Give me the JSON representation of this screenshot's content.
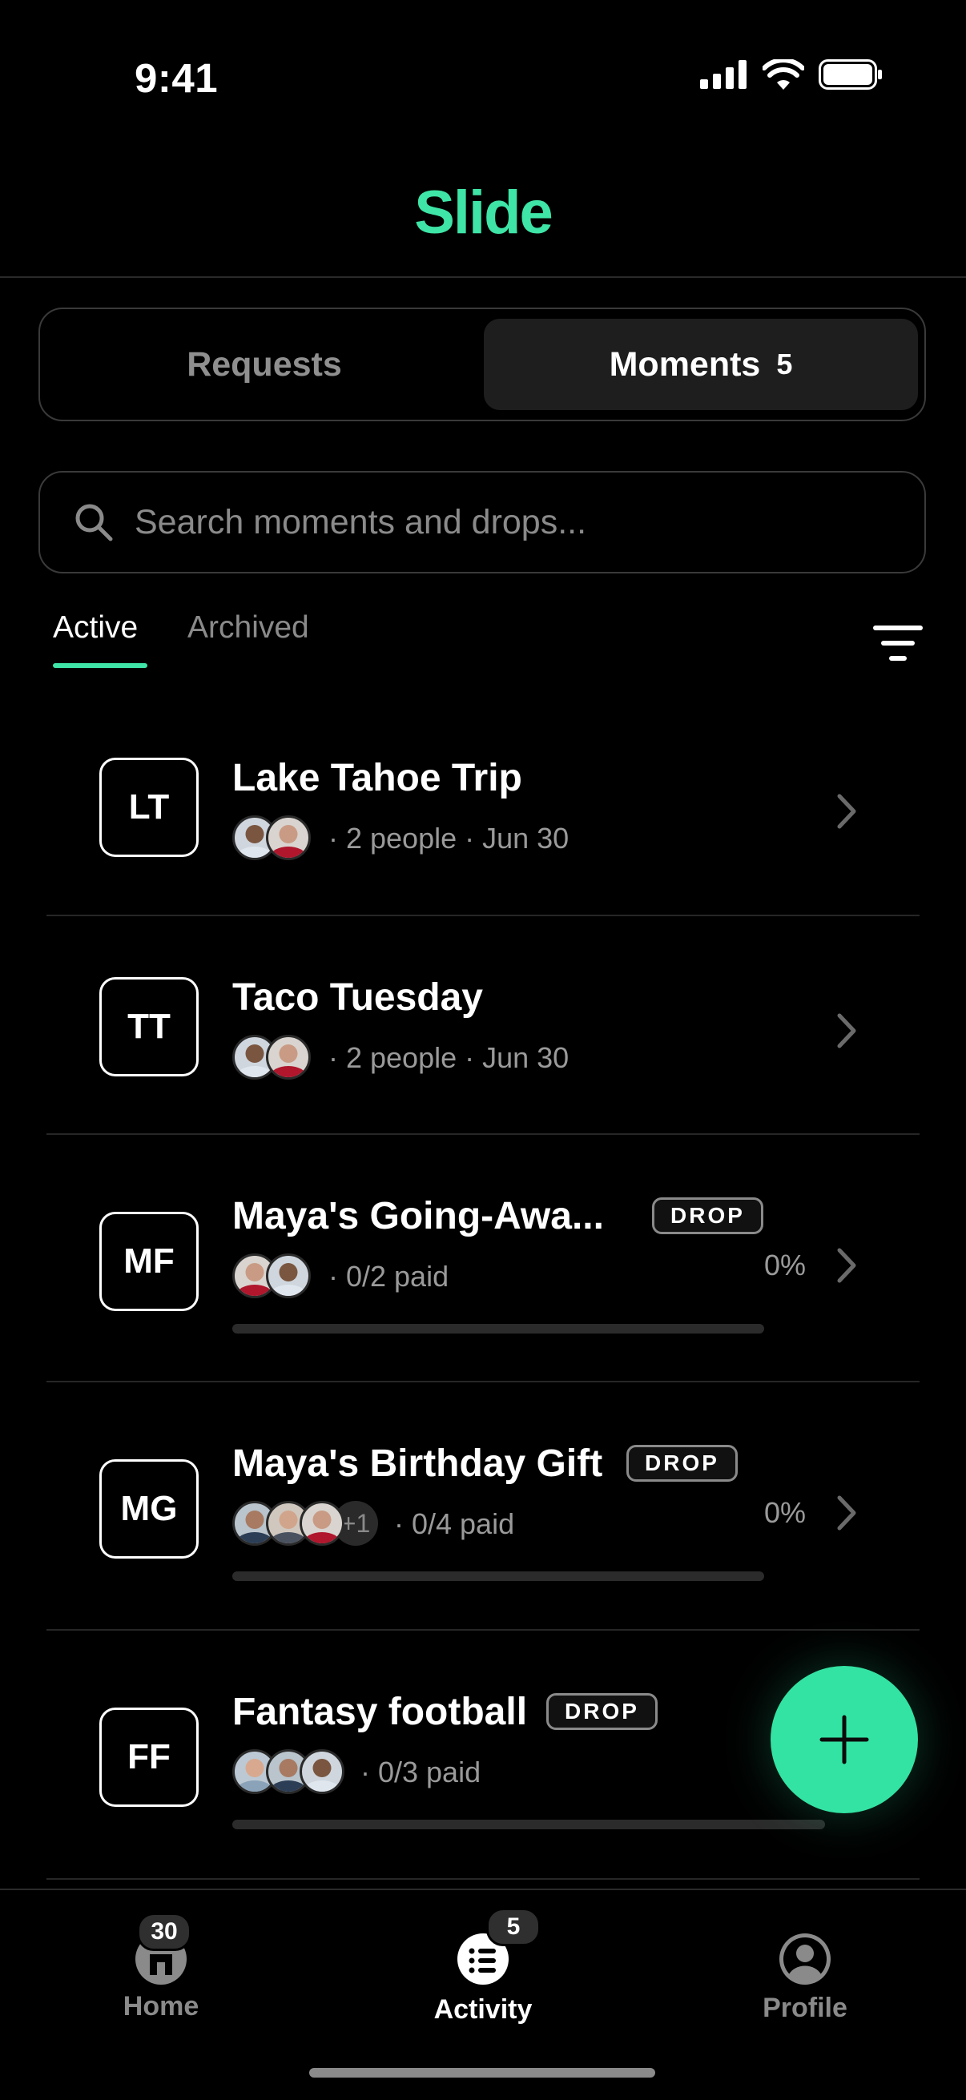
{
  "status_bar": {
    "time": "9:41"
  },
  "header": {
    "app_name": "Slide",
    "brand_color": "#3ee5a6"
  },
  "segmented": {
    "requests_label": "Requests",
    "moments_label": "Moments",
    "moments_count": "5",
    "selected": "Moments"
  },
  "search": {
    "placeholder": "Search moments and drops..."
  },
  "filter_tabs": {
    "active_label": "Active",
    "archived_label": "Archived",
    "selected": "Active"
  },
  "moments": [
    {
      "initials": "LT",
      "title": "Lake Tahoe Trip",
      "meta": "· 2 people · Jun 30",
      "drop": false
    },
    {
      "initials": "TT",
      "title": "Taco Tuesday",
      "meta": "· 2 people · Jun 30",
      "drop": false
    },
    {
      "initials": "MF",
      "title": "Maya's Going-Awa...",
      "badge": "DROP",
      "meta": "· 0/2 paid",
      "percent": "0%",
      "progress": 0,
      "drop": true
    },
    {
      "initials": "MG",
      "title": "Maya's Birthday Gift",
      "badge": "DROP",
      "meta": "· 0/4 paid",
      "extra_people": "+1",
      "percent": "0%",
      "progress": 0,
      "drop": true
    },
    {
      "initials": "FF",
      "title": "Fantasy football",
      "badge": "DROP",
      "meta": "· 0/3 paid",
      "progress": 0,
      "drop": true
    }
  ],
  "tab_bar": {
    "home": {
      "label": "Home",
      "badge": "30"
    },
    "activity": {
      "label": "Activity",
      "badge": "5"
    },
    "profile": {
      "label": "Profile"
    },
    "selected": "Activity"
  }
}
